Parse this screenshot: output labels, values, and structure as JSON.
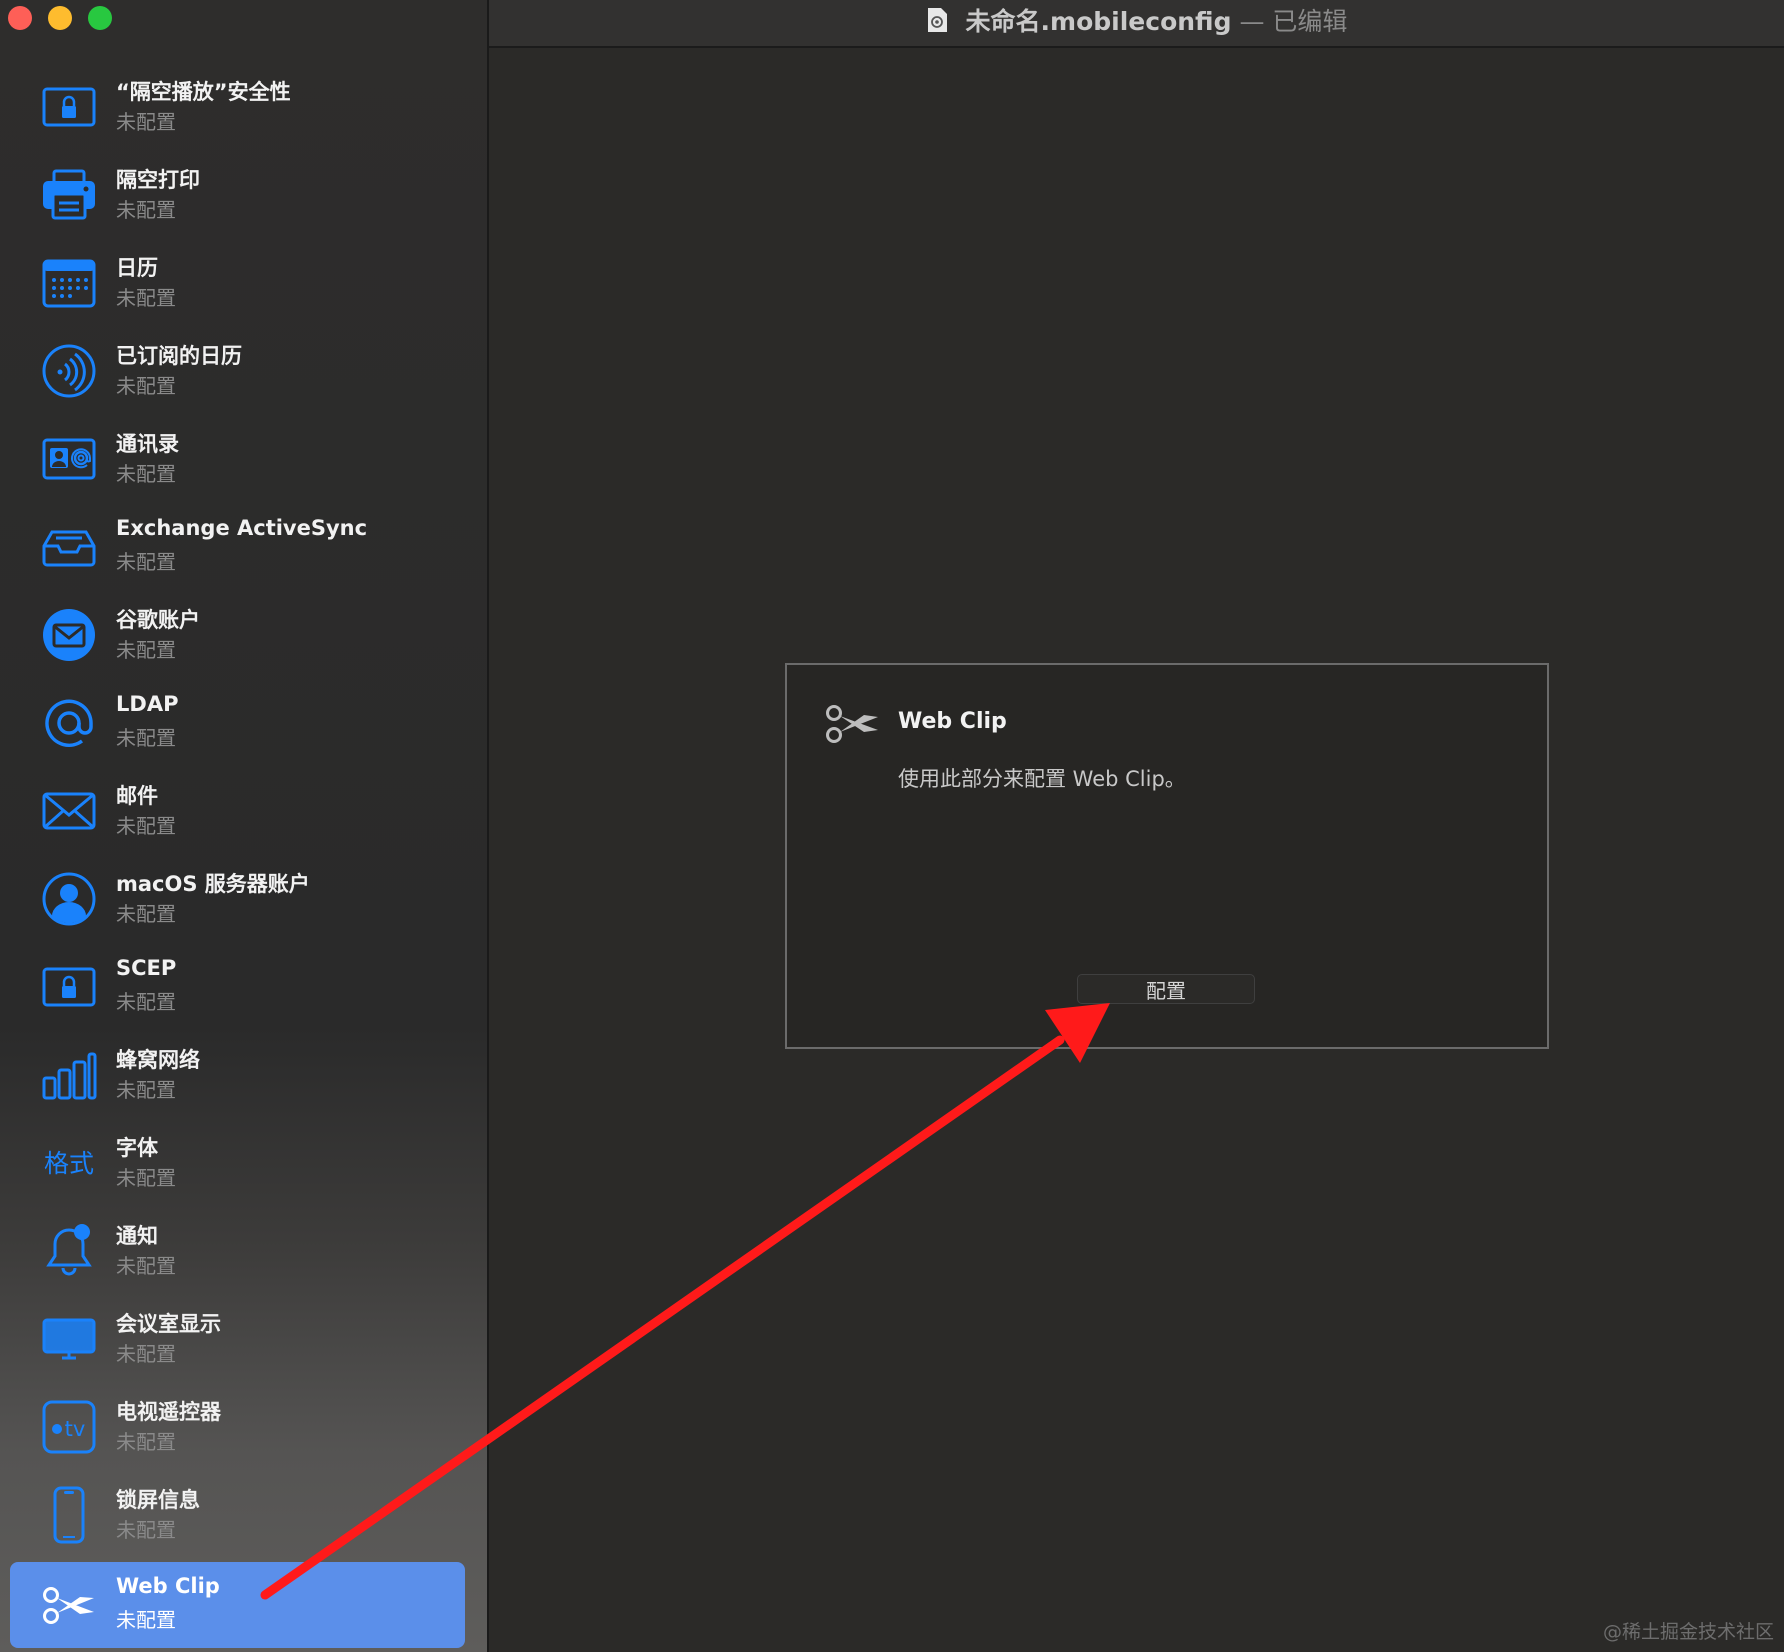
{
  "window": {
    "title_filename": "未命名.mobileconfig",
    "title_separator": "—",
    "title_status": "已编辑"
  },
  "sidebar": {
    "items": [
      {
        "label": "“隔空播放”安全性",
        "status": "未配置",
        "icon": "lock-icon"
      },
      {
        "label": "隔空打印",
        "status": "未配置",
        "icon": "printer-icon"
      },
      {
        "label": "日历",
        "status": "未配置",
        "icon": "calendar-icon"
      },
      {
        "label": "已订阅的日历",
        "status": "未配置",
        "icon": "subscribed-calendar-icon"
      },
      {
        "label": "通讯录",
        "status": "未配置",
        "icon": "contacts-card-icon"
      },
      {
        "label": "Exchange ActiveSync",
        "status": "未配置",
        "icon": "inbox-tray-icon"
      },
      {
        "label": "谷歌账户",
        "status": "未配置",
        "icon": "mail-circle-icon"
      },
      {
        "label": "LDAP",
        "status": "未配置",
        "icon": "at-sign-icon"
      },
      {
        "label": "邮件",
        "status": "未配置",
        "icon": "envelope-icon"
      },
      {
        "label": "macOS 服务器账户",
        "status": "未配置",
        "icon": "person-circle-icon"
      },
      {
        "label": "SCEP",
        "status": "未配置",
        "icon": "lock-icon"
      },
      {
        "label": "蜂窝网络",
        "status": "未配置",
        "icon": "cellular-bars-icon"
      },
      {
        "label": "字体",
        "status": "未配置",
        "icon": "font-format-icon",
        "icon_text": "格式"
      },
      {
        "label": "通知",
        "status": "未配置",
        "icon": "bell-badge-icon"
      },
      {
        "label": "会议室显示",
        "status": "未配置",
        "icon": "display-icon"
      },
      {
        "label": "电视遥控器",
        "status": "未配置",
        "icon": "appletv-icon",
        "icon_text": "tv"
      },
      {
        "label": "锁屏信息",
        "status": "未配置",
        "icon": "iphone-icon"
      },
      {
        "label": "Web Clip",
        "status": "未配置",
        "icon": "scissors-icon",
        "selected": true
      }
    ]
  },
  "panel": {
    "title": "Web Clip",
    "description": "使用此部分来配置 Web Clip。",
    "configure_button": "配置"
  },
  "watermark": "@稀土掘金技术社区",
  "colors": {
    "accent": "#5b8fea",
    "icon_blue": "#1a82fb",
    "annotation_arrow": "#ff1a1a"
  }
}
